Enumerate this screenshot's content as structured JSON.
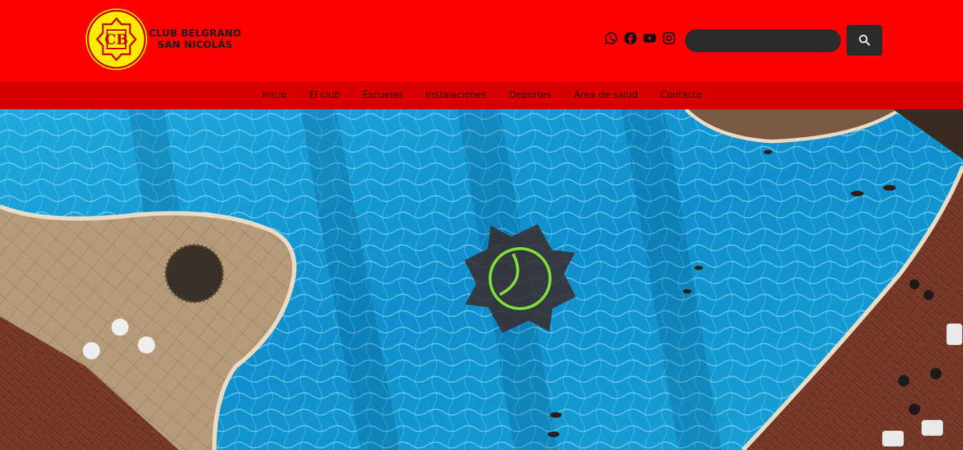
{
  "brand": {
    "line1": "CLUB BELGRANO",
    "line2": "SAN NICOLÁS",
    "monogram": "CB",
    "colors": {
      "primary": "#ff0000",
      "nav": "#d90000",
      "emblem": "#ffea00",
      "dark": "#2b2b2b"
    }
  },
  "social": [
    {
      "name": "whatsapp-icon"
    },
    {
      "name": "facebook-icon"
    },
    {
      "name": "youtube-icon"
    },
    {
      "name": "instagram-icon"
    }
  ],
  "search": {
    "placeholder": "",
    "value": "",
    "button_icon": "search-icon"
  },
  "nav": {
    "items": [
      {
        "label": "Inicio"
      },
      {
        "label": "El club"
      },
      {
        "label": "Escuelas"
      },
      {
        "label": "Instalaciones"
      },
      {
        "label": "Deportes"
      },
      {
        "label": "Area de salud"
      },
      {
        "label": "Contacto"
      }
    ]
  },
  "hero": {
    "image": "aerial-pool-photo"
  }
}
